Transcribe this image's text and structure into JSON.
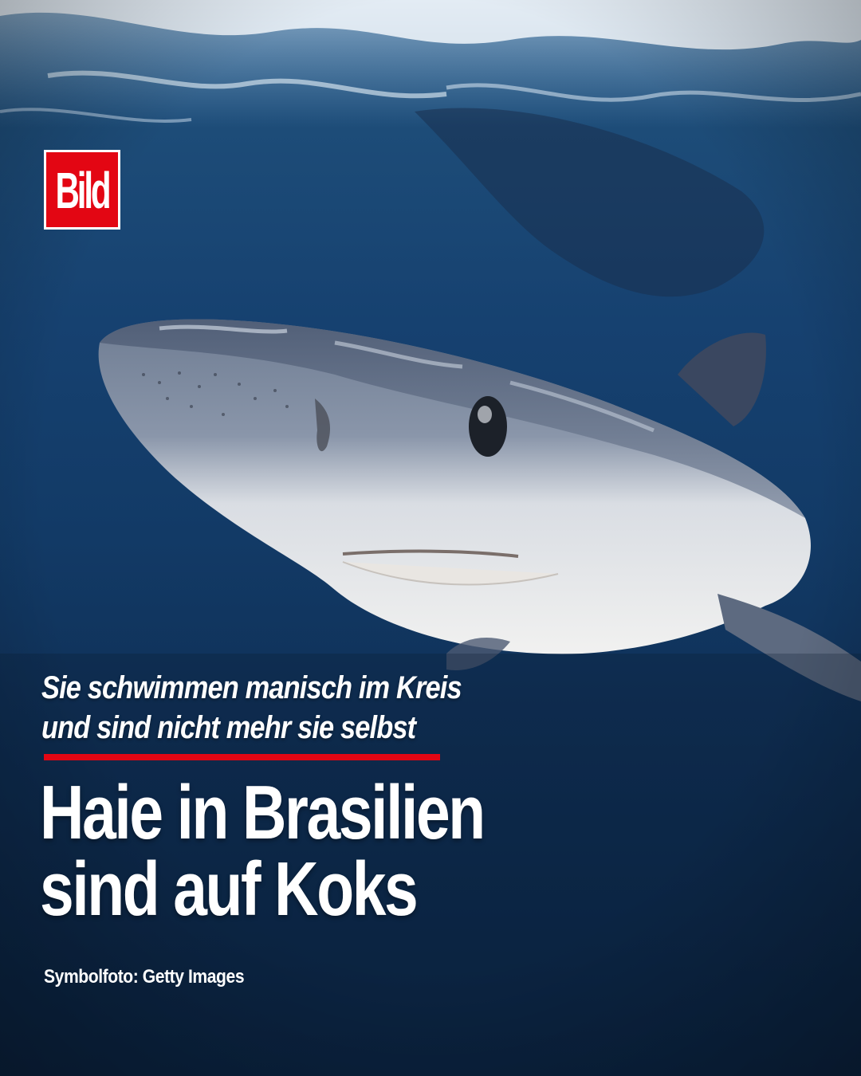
{
  "logo": {
    "text": "Bild",
    "color": "#e30613"
  },
  "kicker": {
    "line1": "Sie schwimmen manisch im Kreis",
    "line2": "und sind nicht mehr sie selbst"
  },
  "headline": {
    "line1": "Haie in Brasilien",
    "line2": "sind auf Koks"
  },
  "credit": "Symbolfoto: Getty Images",
  "colors": {
    "accent": "#e30613",
    "water_top": "#2a5f8f",
    "water_bottom": "#0b2442",
    "text": "#ffffff"
  },
  "image": {
    "subject": "shark-underwater-photo"
  }
}
